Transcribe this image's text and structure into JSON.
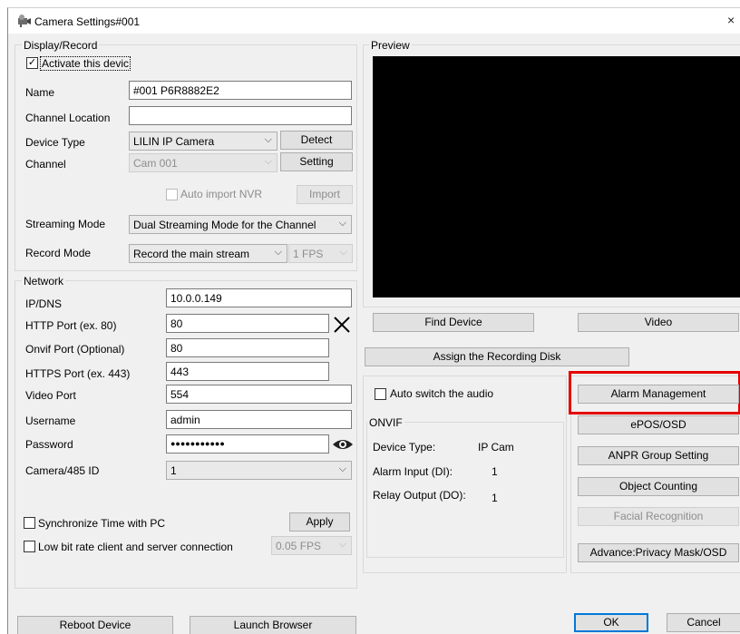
{
  "window": {
    "title": "Camera Settings#001",
    "close": "×"
  },
  "display": {
    "legend": "Display/Record",
    "activate_label": "Activate this devic",
    "activate_checked": true,
    "name_label": "Name",
    "name_value": "#001 P6R8882E2",
    "channel_location_label": "Channel Location",
    "channel_location_value": "",
    "device_type_label": "Device Type",
    "device_type_value": "LILIN IP Camera",
    "detect_button": "Detect",
    "channel_label": "Channel",
    "channel_value": "Cam 001",
    "setting_button": "Setting",
    "auto_import_label": "Auto import NVR",
    "import_button": "Import",
    "streaming_mode_label": "Streaming Mode",
    "streaming_mode_value": "Dual Streaming Mode for the Channel",
    "record_mode_label": "Record Mode",
    "record_mode_value": "Record the main stream",
    "fps_value": "1 FPS"
  },
  "network": {
    "legend": "Network",
    "ipdns_label": "IP/DNS",
    "ipdns_value": "10.0.0.149",
    "http_label": "HTTP Port (ex. 80)",
    "http_value": "80",
    "onvif_label": "Onvif Port (Optional)",
    "onvif_value": "80",
    "https_label": "HTTPS Port (ex. 443)",
    "https_value": "443",
    "video_port_label": "Video Port",
    "video_port_value": "554",
    "username_label": "Username",
    "username_value": "admin",
    "password_label": "Password",
    "password_value": "●●●●●●●●●●●",
    "camera485_label": "Camera/485 ID",
    "camera485_value": "1",
    "sync_time_label": "Synchronize Time with PC",
    "apply_button": "Apply",
    "low_bitrate_label": "Low bit rate client and server connection",
    "low_bitrate_fps": "0.05 FPS"
  },
  "preview": {
    "legend": "Preview",
    "find_device_button": "Find Device",
    "video_button": "Video",
    "assign_disk_button": "Assign the Recording Disk"
  },
  "audio": {
    "auto_switch_label": "Auto switch the audio"
  },
  "onvif": {
    "legend": "ONVIF",
    "device_type_label": "Device Type:",
    "device_type_value": "IP Cam",
    "alarm_input_label": "Alarm Input (DI):",
    "alarm_input_value": "1",
    "relay_output_label": "Relay Output (DO):",
    "relay_output_value": "1"
  },
  "side_buttons": {
    "alarm_management": "Alarm Management",
    "epos_osd": "ePOS/OSD",
    "anpr_group": "ANPR Group Setting",
    "object_counting": "Object Counting",
    "facial_recognition": "Facial Recognition",
    "advance_privacy": "Advance:Privacy Mask/OSD"
  },
  "footer": {
    "reboot_button": "Reboot Device",
    "launch_browser_button": "Launch Browser",
    "ok_button": "OK",
    "cancel_button": "Cancel"
  },
  "colors": {
    "highlight_box": "#e50000",
    "accent": "#0078d7",
    "preview_bg": "#000000"
  }
}
